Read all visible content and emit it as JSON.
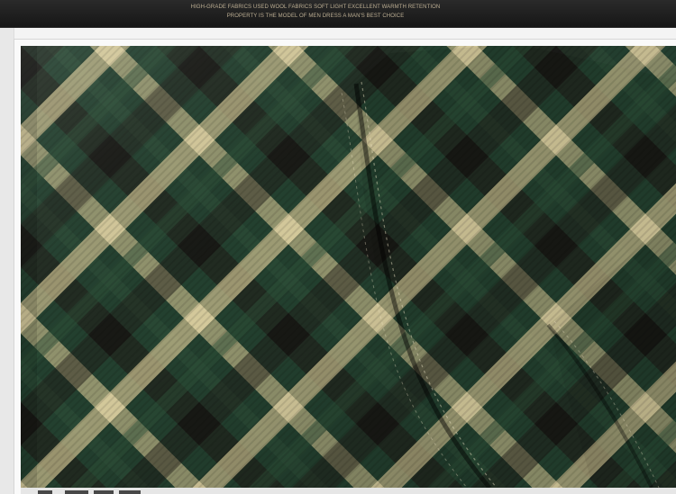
{
  "banner": {
    "line1": "HIGH-GRADE FABRICS USED WOOL FABRICS SOFT LIGHT EXCELLENT WARMTH RETENTION",
    "line2": "PROPERTY IS THE MODEL OF MEN DRESS A MAN'S BEST CHOICE"
  },
  "photo": {
    "subject": "plaid-shirt-sleeve-detail",
    "colors": {
      "dark_green": "#1f3a2a",
      "mid_green": "#2e4f38",
      "khaki": "#c6b98b",
      "dark_brown": "#1f1a16",
      "light_gray_bg": "#f3f3f3"
    }
  }
}
